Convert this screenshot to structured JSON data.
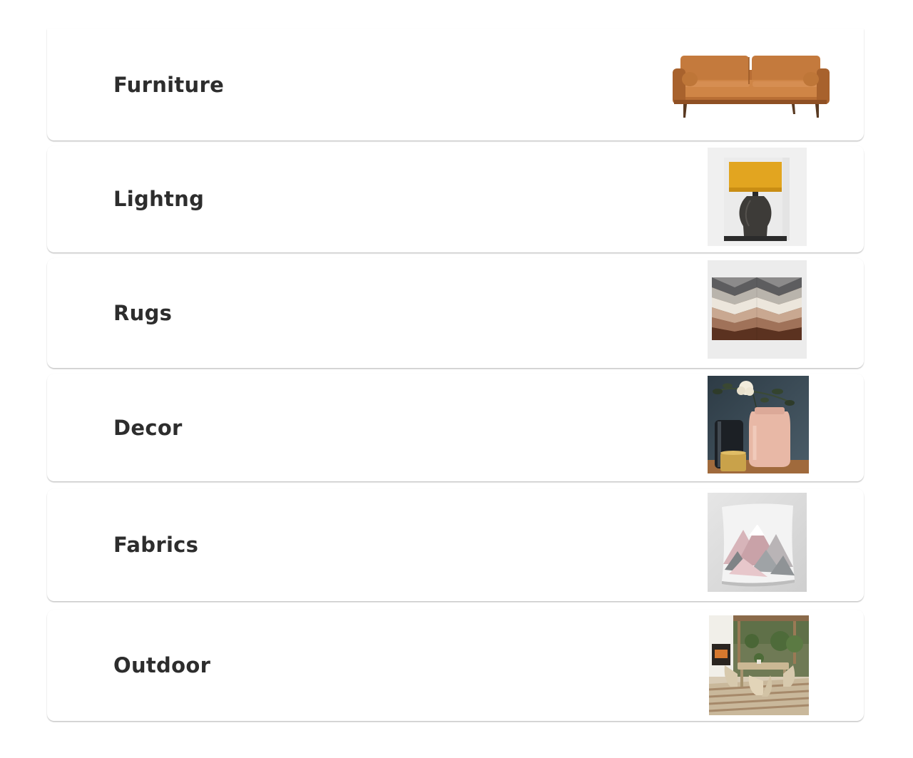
{
  "categories": [
    {
      "label": "Furniture",
      "image": "sofa"
    },
    {
      "label": "Lightng",
      "image": "table-lamp"
    },
    {
      "label": "Rugs",
      "image": "geometric-rug"
    },
    {
      "label": "Decor",
      "image": "vases-with-flowers"
    },
    {
      "label": "Fabrics",
      "image": "throw-pillow"
    },
    {
      "label": "Outdoor",
      "image": "patio-dining-set"
    }
  ]
}
